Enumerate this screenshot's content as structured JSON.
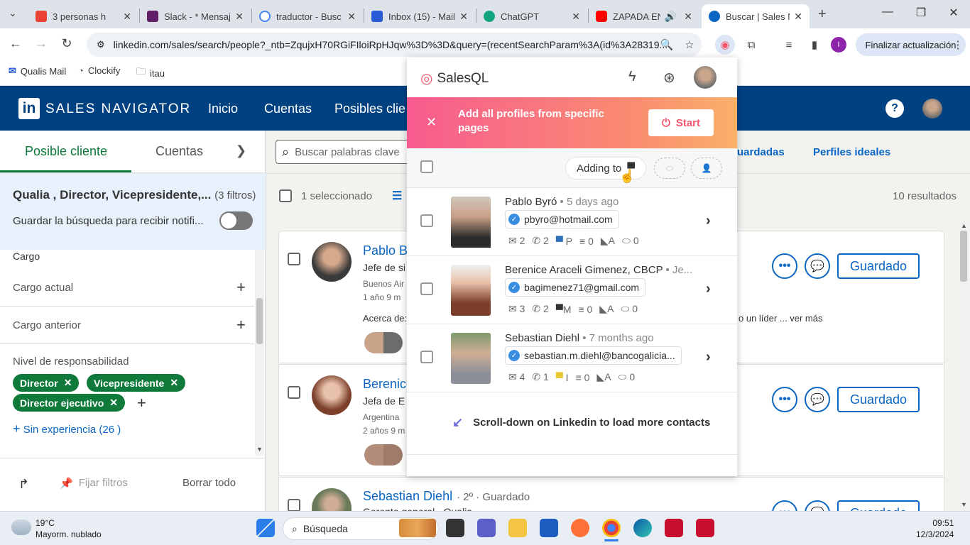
{
  "browser": {
    "tabs": [
      {
        "title": "3 personas h",
        "color": "#ea4335"
      },
      {
        "title": "Slack - * Mensaj",
        "color": "#611f69"
      },
      {
        "title": "traductor - Busc",
        "color": "#4285f4"
      },
      {
        "title": "Inbox (15) - Mail",
        "color": "#2a5bd7"
      },
      {
        "title": "ChatGPT",
        "color": "#10a37f"
      },
      {
        "title": "ZAPADA EN",
        "color": "#ff0000"
      },
      {
        "title": "Buscar | Sales N",
        "color": "#0a66c2"
      }
    ],
    "url": "linkedin.com/sales/search/people?_ntb=ZqujxH70RGiFIloiRpHJqw%3D%3D&query=(recentSearchParam%3A(id%3A28319...",
    "update_label": "Finalizar actualización",
    "profile_initial": "I",
    "bookmarks": [
      "Qualis Mail",
      "Clockify",
      "itau"
    ]
  },
  "linkedin": {
    "brand": "SALES NAVIGATOR",
    "logo": "in",
    "nav": [
      "Inicio",
      "Cuentas",
      "Posibles clie"
    ],
    "left_tabs": [
      "Posible cliente",
      "Cuentas"
    ],
    "filters_title": "Qualia , Director, Vicepresidente,...",
    "filters_count": "(3 filtros)",
    "save_search": "Guardar la búsqueda para recibir notifi...",
    "section_cargo": "Cargo",
    "cargo_actual": "Cargo actual",
    "cargo_anterior": "Cargo anterior",
    "nivel": "Nivel de responsabilidad",
    "chips": [
      "Director",
      "Vicepresidente",
      "Director ejecutivo"
    ],
    "sin_experiencia": "Sin experiencia (26 )",
    "fijar": "Fijar filtros",
    "borrar": "Borrar todo",
    "search_placeholder": "Buscar palabras clave",
    "top_links": [
      "uardadas",
      "Perfiles ideales"
    ],
    "selected": "1 seleccionado",
    "results": "10 resultados",
    "cards": [
      {
        "name": "Pablo B",
        "line1": "Jefe de si",
        "line2": "Buenos Air",
        "line3": "1 año 9 m",
        "about": "Acerca de:",
        "about_tail": "o un líder ... ver más",
        "button": "Guardado"
      },
      {
        "name": "Berenice",
        "line1": "Jefa de E",
        "line2": "Argentina",
        "line3": "2 años 9 m",
        "button": "Guardado"
      },
      {
        "name": "Sebastian Diehl",
        "degree": "· 2º · Guardado",
        "line1": "Gerente general - Qualia",
        "button": "Guardado"
      }
    ]
  },
  "salesql": {
    "brand": "SalesQL",
    "banner_text": "Add all profiles from specific pages",
    "start_label": "Start",
    "adding_to": "Adding to",
    "contacts": [
      {
        "name": "Pablo Byró",
        "meta": " • 5 days ago",
        "email": "pbyro@hotmail.com",
        "stats": [
          "2",
          "2",
          "P",
          "0",
          "A",
          "0"
        ],
        "folder_color": "#2d6fb8"
      },
      {
        "name": "Berenice Araceli Gimenez, CBCP",
        "meta": " • Je...",
        "email": "bagimenez71@gmail.com",
        "stats": [
          "3",
          "2",
          "M",
          "0",
          "A",
          "0"
        ],
        "folder_color": "#333333"
      },
      {
        "name": "Sebastian Diehl",
        "meta": " • 7 months ago",
        "email": "sebastian.m.diehl@bancogalicia...",
        "stats": [
          "4",
          "1",
          "I",
          "0",
          "A",
          "0"
        ],
        "folder_color": "#e8c82c"
      }
    ],
    "scroll_msg": "Scroll-down on Linkedin to load more contacts"
  },
  "taskbar": {
    "temp": "19°C",
    "weather": "Mayorm. nublado",
    "search": "Búsqueda",
    "time": "09:51",
    "date": "12/3/2024"
  }
}
